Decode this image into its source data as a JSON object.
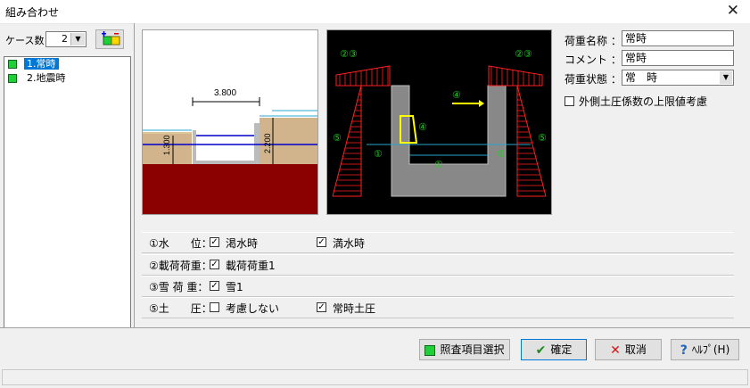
{
  "window": {
    "title": "組み合わせ"
  },
  "cases": {
    "label": "ケース数：",
    "count": "2",
    "items": [
      {
        "label": "1.常時"
      },
      {
        "label": "2.地震時"
      }
    ]
  },
  "figure_left": {
    "dim_top": "3.800",
    "dim_left": "1.300",
    "dim_right": "2.200"
  },
  "figure_right": {
    "label_23_left": "②③",
    "label_23_right": "②③",
    "label_4_load": "④",
    "label_4_body": "④",
    "label_5_left": "⑤",
    "label_5_right": "⑤",
    "label_1_left": "①",
    "label_1_mid": "①",
    "label_1_right": "①"
  },
  "form": {
    "load_name_label": "荷重名称 ：",
    "load_name_value": "常時",
    "comment_label": "コメント ：",
    "comment_value": "常時",
    "load_state_label": "荷重状態 ：",
    "load_state_value": "常　時",
    "upper_limit_label": "外側土圧係数の上限値考慮"
  },
  "options": [
    {
      "head": "①水　　位：",
      "a_label": "渇水時",
      "a_checked": "✓",
      "b_label": "満水時",
      "b_checked": "✓"
    },
    {
      "head": "②載荷荷重：",
      "a_label": "載荷荷重1",
      "a_checked": "✓"
    },
    {
      "head": "③雪 荷 重：",
      "a_label": "雪1",
      "a_checked": "✓"
    },
    {
      "head": "⑤土　　圧：",
      "a_label": "考慮しない",
      "a_checked": "",
      "b_label": "常時土圧",
      "b_checked": "✓"
    }
  ],
  "buttons": {
    "check_items": "照査項目選択",
    "ok": "確定",
    "cancel": "取消",
    "help": "ﾍﾙﾌﾟ(H)"
  },
  "colors": {
    "selection": "#0078d7",
    "ground": "#8b0000",
    "soil": "#d2b48c",
    "red_arrows": "#ff2020",
    "green_labels": "#22cc22"
  }
}
